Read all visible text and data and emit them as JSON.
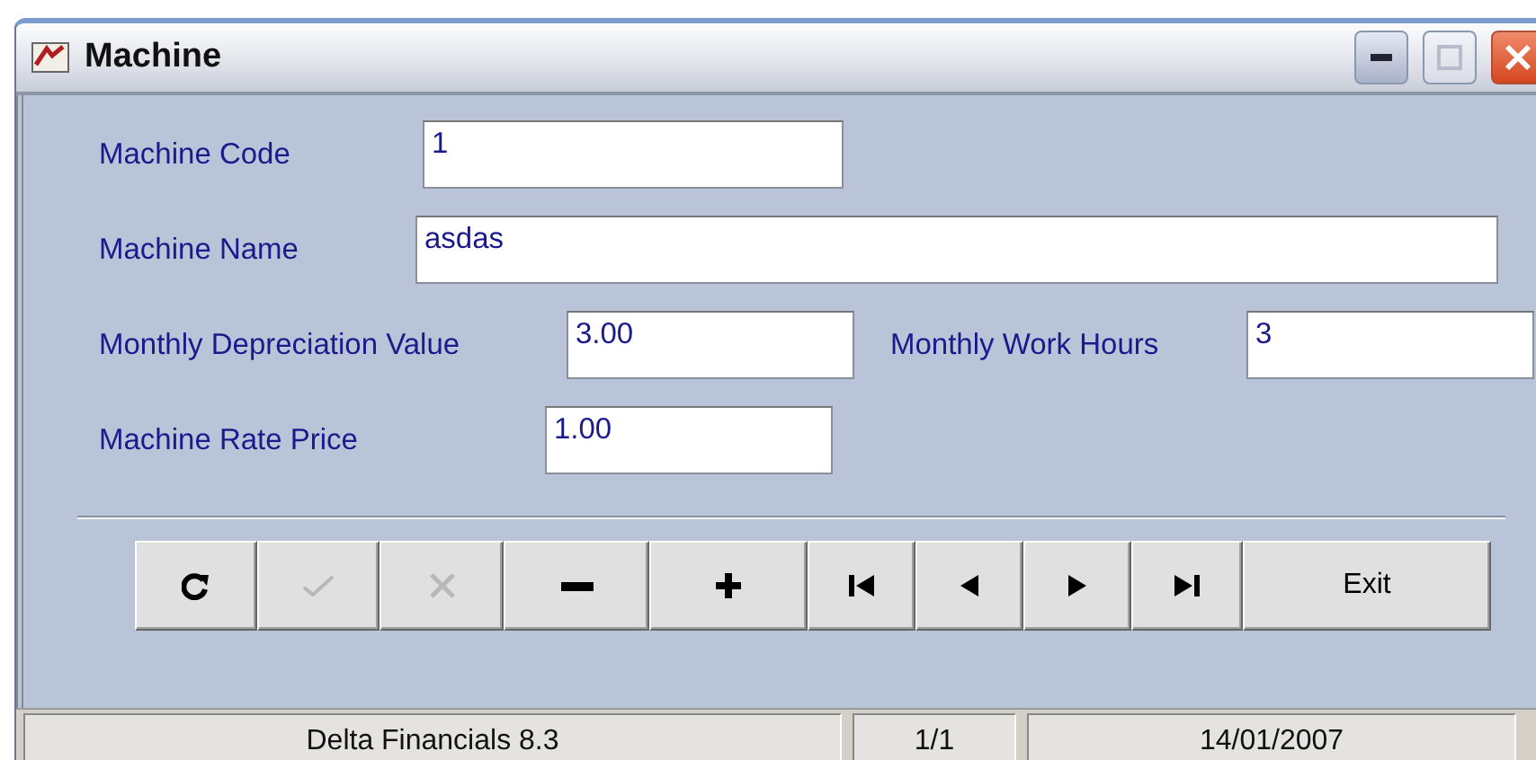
{
  "window": {
    "title": "Machine",
    "controls": [
      {
        "kind": "minimize",
        "disabled": false
      },
      {
        "kind": "maximize",
        "disabled": true
      },
      {
        "kind": "close",
        "disabled": false
      }
    ]
  },
  "rows": [
    {
      "fields": [
        {
          "label": "Machine Code",
          "value": "1"
        }
      ]
    },
    {
      "fields": [
        {
          "label": "Machine Name",
          "value": "asdas"
        }
      ]
    },
    {
      "fields": [
        {
          "label": "Monthly Depreciation Value",
          "value": "3.00"
        },
        {
          "label": "Monthly Work Hours",
          "value": "3"
        }
      ]
    },
    {
      "fields": [
        {
          "label": "Machine Rate Price",
          "value": "1.00"
        }
      ]
    }
  ],
  "buttons": [
    {
      "kind": "refresh",
      "disabled": false
    },
    {
      "kind": "confirm",
      "disabled": true
    },
    {
      "kind": "cancel",
      "disabled": true
    },
    {
      "kind": "delete",
      "disabled": false
    },
    {
      "kind": "add",
      "disabled": false
    },
    {
      "kind": "first",
      "disabled": false
    },
    {
      "kind": "prev",
      "disabled": false
    },
    {
      "kind": "next",
      "disabled": false
    },
    {
      "kind": "last",
      "disabled": false
    },
    {
      "kind": "text",
      "label": "Exit",
      "disabled": false
    }
  ],
  "status_bar": [
    "Delta Financials 8.3",
    "1/1",
    "14/01/2007"
  ]
}
